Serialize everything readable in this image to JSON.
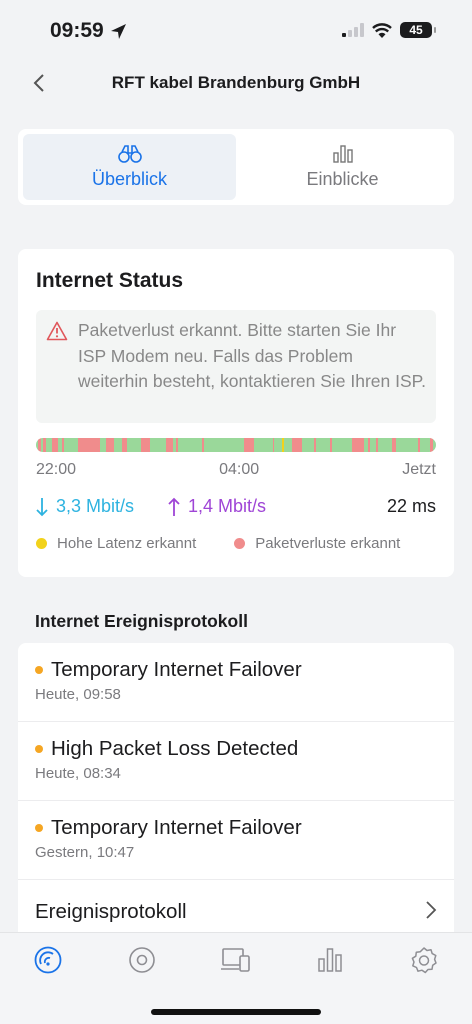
{
  "status_bar": {
    "time": "09:59",
    "battery": "45"
  },
  "nav": {
    "title": "RFT kabel Brandenburg GmbH"
  },
  "tabs": [
    {
      "label": "Überblick",
      "icon": "binoculars-icon",
      "active": true
    },
    {
      "label": "Einblicke",
      "icon": "bar-chart-icon",
      "active": false
    }
  ],
  "status_card": {
    "title": "Internet Status",
    "alert_text": "Paketverlust erkannt. Bitte starten Sie Ihr ISP Modem neu. Falls das Problem weiterhin besteht, kontaktieren Sie Ihren ISP.",
    "time_labels": {
      "start": "22:00",
      "mid": "04:00",
      "end": "Jetzt"
    },
    "download": "3,3 Mbit/s",
    "upload": "1,4 Mbit/s",
    "latency": "22 ms",
    "legend": {
      "high_latency": "Hohe Latenz erkannt",
      "packet_loss": "Paketverluste erkannt"
    },
    "colors": {
      "ok": "#9ad89a",
      "loss": "#f08c8c",
      "latency": "#f2d21b",
      "download": "#2eb3e0",
      "upload": "#9f45d6"
    }
  },
  "events": {
    "section_title": "Internet Ereignisprotokoll",
    "items": [
      {
        "title": "Temporary Internet Failover",
        "time": "Heute, 09:58"
      },
      {
        "title": "High Packet Loss Detected",
        "time": "Heute, 08:34"
      },
      {
        "title": "Temporary Internet Failover",
        "time": "Gestern, 10:47"
      }
    ],
    "log_link": "Ereignisprotokoll"
  },
  "tabbar": [
    "internet-icon",
    "radar-icon",
    "devices-icon",
    "insights-icon",
    "settings-icon"
  ]
}
